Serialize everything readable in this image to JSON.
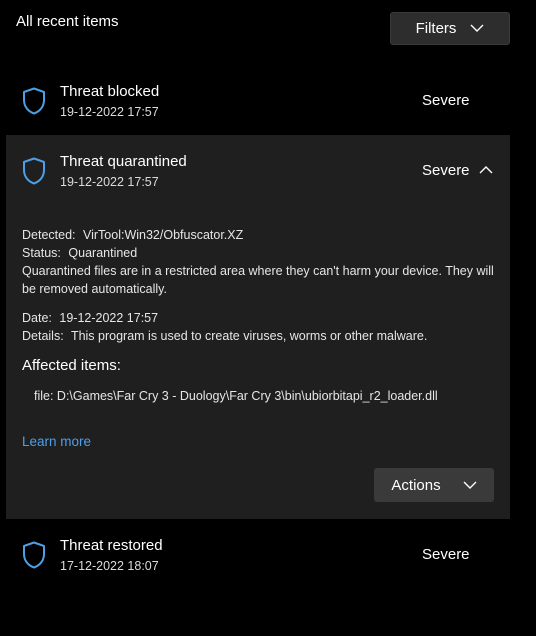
{
  "header": {
    "title": "All recent items",
    "filters_label": "Filters"
  },
  "colors": {
    "accent": "#4ca0e8",
    "panel": "#1f1f1f",
    "background": "#000000"
  },
  "items": [
    {
      "icon": "shield-icon",
      "title": "Threat blocked",
      "time": "19-12-2022 17:57",
      "severity": "Severe"
    },
    {
      "icon": "shield-icon",
      "title": "Threat quarantined",
      "time": "19-12-2022 17:57",
      "severity": "Severe",
      "expanded": true,
      "details": {
        "detected_label": "Detected:",
        "detected_value": "VirTool:Win32/Obfuscator.XZ",
        "status_label": "Status:",
        "status_value": "Quarantined",
        "status_desc": "Quarantined files are in a restricted area where they can't harm your device. They will be removed automatically.",
        "date_label": "Date:",
        "date_value": "19-12-2022 17:57",
        "details_label": "Details:",
        "details_value": "This program is used to create viruses, worms or other malware.",
        "affected_title": "Affected items:",
        "affected_file": "file: D:\\Games\\Far Cry 3 - Duology\\Far Cry 3\\bin\\ubiorbitapi_r2_loader.dll",
        "learn_more": "Learn more",
        "actions_label": "Actions"
      }
    },
    {
      "icon": "shield-icon",
      "title": "Threat restored",
      "time": "17-12-2022 18:07",
      "severity": "Severe"
    }
  ]
}
